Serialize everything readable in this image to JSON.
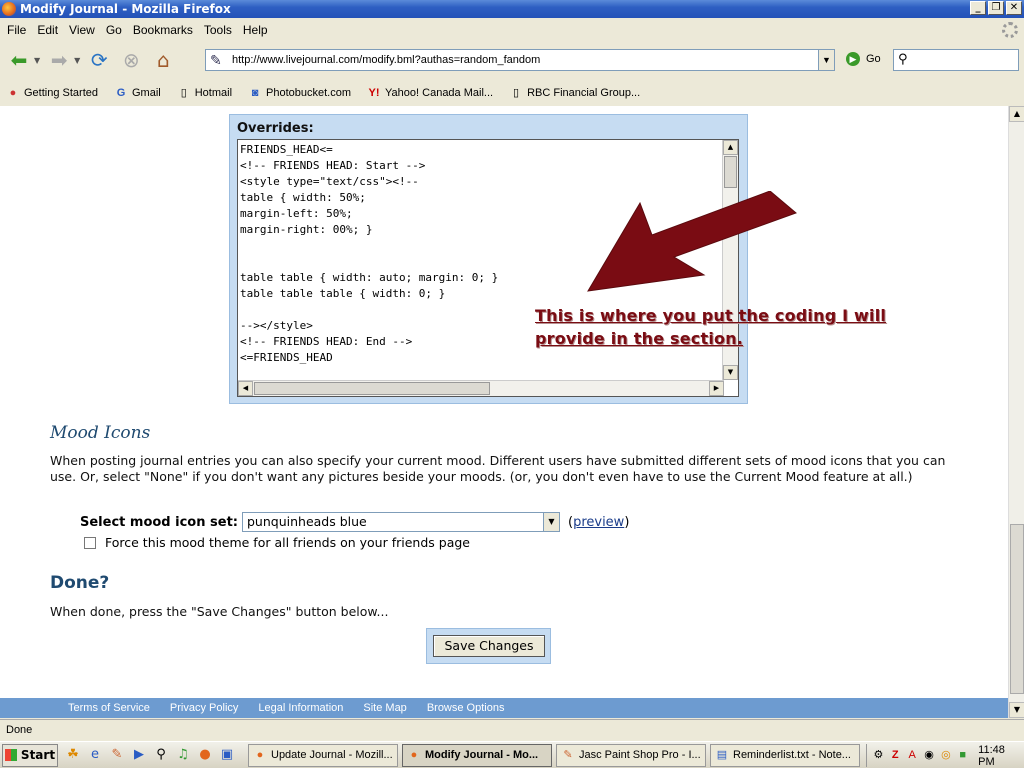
{
  "window": {
    "title": "Modify Journal - Mozilla Firefox"
  },
  "menu": [
    "File",
    "Edit",
    "View",
    "Go",
    "Bookmarks",
    "Tools",
    "Help"
  ],
  "navbar": {
    "url": "http://www.livejournal.com/modify.bml?authas=random_fandom",
    "go_label": "Go"
  },
  "bookmarks": [
    {
      "label": "Getting Started",
      "icon": "firefox-icon"
    },
    {
      "label": "Gmail",
      "icon": "google-icon"
    },
    {
      "label": "Hotmail",
      "icon": "page-icon"
    },
    {
      "label": "Photobucket.com",
      "icon": "camera-icon"
    },
    {
      "label": "Yahoo! Canada Mail...",
      "icon": "yahoo-icon"
    },
    {
      "label": "RBC Financial Group...",
      "icon": "page-icon"
    }
  ],
  "overrides": {
    "label": "Overrides:",
    "code": "FRIENDS_HEAD<=\n<!-- FRIENDS HEAD: Start -->\n<style type=\"text/css\"><!--\ntable { width: 50%;\nmargin-left: 50%;\nmargin-right: 00%; }\n\n\ntable table { width: auto; margin: 0; }\ntable table table { width: 0; }\n\n--></style>\n<!-- FRIENDS HEAD: End -->\n<=FRIENDS_HEAD"
  },
  "annotation": {
    "line1": "This is where you put the coding I will",
    "line2": "provide in the section.",
    "color": "#7a0c13"
  },
  "mood": {
    "title": "Mood Icons",
    "description": "When posting journal entries you can also specify your current mood. Different users have submitted different sets of mood icons that you can use. Or, select \"None\" if you don't want any pictures beside your moods. (or, you don't even have to use the Current Mood feature at all.)",
    "select_label": "Select mood icon set:",
    "selected": "punquinheads blue",
    "preview_open": "(",
    "preview_link": "preview",
    "preview_close": ")",
    "force_label": "Force this mood theme for all friends on your friends page"
  },
  "done": {
    "title": "Done?",
    "description": "When done, press the \"Save Changes\" button below...",
    "save_label": "Save Changes"
  },
  "footer": [
    "Terms of Service",
    "Privacy Policy",
    "Legal Information",
    "Site Map",
    "Browse Options"
  ],
  "status": "Done",
  "taskbar": {
    "start": "Start",
    "tasks": [
      {
        "label": "Update Journal - Mozill...",
        "active": false
      },
      {
        "label": "Modify Journal - Mo...",
        "active": true
      },
      {
        "label": "Jasc Paint Shop Pro - I...",
        "active": false
      },
      {
        "label": "Reminderlist.txt - Note...",
        "active": false
      }
    ],
    "clock": "11:48 PM"
  },
  "colors": {
    "accent": "#1f4a70",
    "footer_bg": "#6d9bd0",
    "panel_bg": "#c6dcf2"
  }
}
